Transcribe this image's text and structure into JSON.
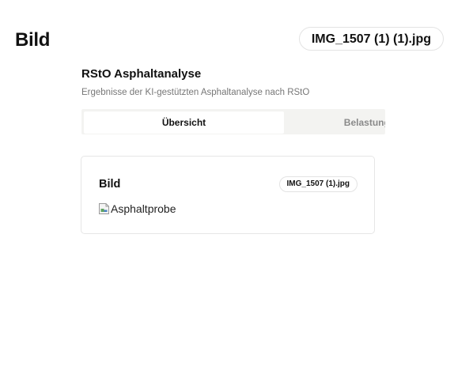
{
  "page": {
    "title": "Bild",
    "file_name": "IMG_1507 (1) (1).jpg"
  },
  "panel": {
    "title": "RStO Asphaltanalyse",
    "subtitle": "Ergebnisse der KI-gestützten Asphaltanalyse nach RStO",
    "tabs": [
      {
        "label": "Übersicht",
        "active": true
      },
      {
        "label": "Belastungsklasse",
        "active": false
      }
    ]
  },
  "card": {
    "title": "Bild",
    "file_name": "IMG_1507 (1).jpg",
    "image_alt": "Asphaltprobe",
    "image_icon": "broken-image-icon"
  }
}
